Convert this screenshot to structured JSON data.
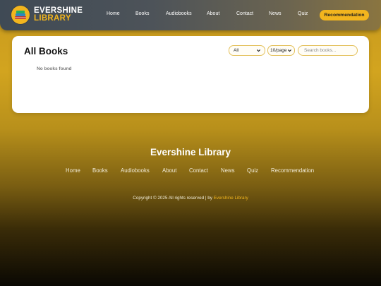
{
  "header": {
    "logo_line1": "EVERSHINE",
    "logo_line2": "LIBRARY",
    "nav": [
      "Home",
      "Books",
      "Audiobooks",
      "About",
      "Contact",
      "News",
      "Quiz"
    ],
    "cta_label": "Recommendation"
  },
  "main": {
    "title": "All Books",
    "category_filter": "All",
    "per_page_select": "10/page",
    "search_placeholder": "Search books...",
    "empty_message": "No books found"
  },
  "footer": {
    "title": "Evershine Library",
    "links": [
      "Home",
      "Books",
      "Audiobooks",
      "About",
      "Contact",
      "News",
      "Quiz",
      "Recommendation"
    ],
    "copyright_text": "Copyright © 2025 All rights reserved | by ",
    "copyright_brand": "Evershine Library"
  },
  "colors": {
    "accent": "#f2b51e",
    "header_bg": "#4d5359",
    "panel_bg": "#ffffff"
  }
}
